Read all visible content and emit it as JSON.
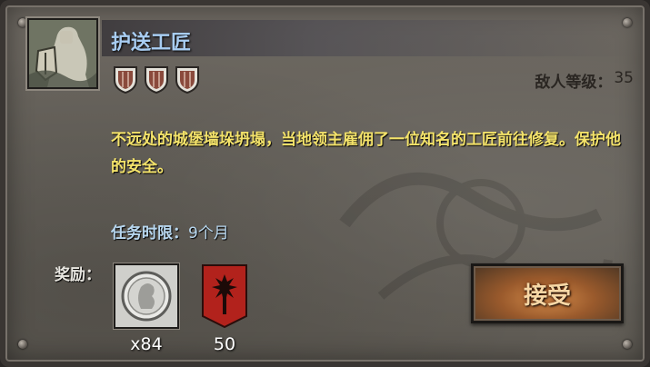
{
  "quest": {
    "title": "护送工匠",
    "icon": "knight-statue-icon",
    "difficulty_shields": 3,
    "enemy_level_label": "敌人等级：",
    "enemy_level_value": "35",
    "description": "不远处的城堡墙垛坍塌，当地领主雇佣了一位知名的工匠前往修复。保护他的安全。",
    "time_limit_label": "任务时限：",
    "time_limit_value": "9个月"
  },
  "rewards": {
    "label": "奖励：",
    "items": [
      {
        "icon": "silver-coin-icon",
        "amount": "x84"
      },
      {
        "icon": "faction-banner-icon",
        "amount": "50"
      }
    ]
  },
  "actions": {
    "accept_label": "接受"
  },
  "colors": {
    "title": "#a8cdf2",
    "description": "#f4e36a",
    "time_limit": "#b7d6ee",
    "button_glow": "#d38b4a",
    "banner_red": "#b2221c"
  }
}
